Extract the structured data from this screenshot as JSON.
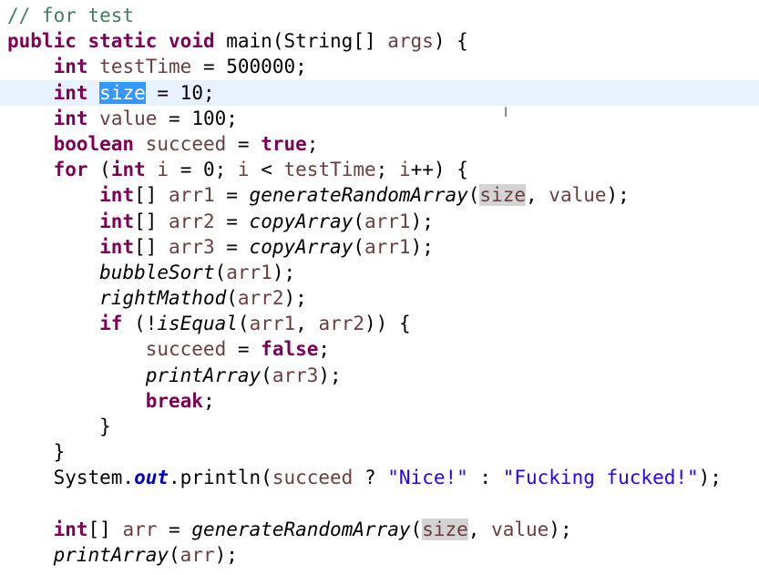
{
  "editor": {
    "language": "java",
    "lines": [
      {
        "tokens": [
          {
            "t": "// for test",
            "c": "cm"
          }
        ]
      },
      {
        "tokens": [
          {
            "t": "public",
            "c": "kw"
          },
          {
            "t": " "
          },
          {
            "t": "static",
            "c": "kw"
          },
          {
            "t": " "
          },
          {
            "t": "void",
            "c": "kw"
          },
          {
            "t": " main(String[] "
          },
          {
            "t": "args",
            "c": "var"
          },
          {
            "t": ") {"
          }
        ]
      },
      {
        "tokens": [
          {
            "t": "    "
          },
          {
            "t": "int",
            "c": "kw"
          },
          {
            "t": " "
          },
          {
            "t": "testTime",
            "c": "var"
          },
          {
            "t": " = 500000;"
          }
        ]
      },
      {
        "current": true,
        "tokens": [
          {
            "t": "    "
          },
          {
            "t": "int",
            "c": "kw"
          },
          {
            "t": " "
          },
          {
            "t": "size",
            "c": "sel"
          },
          {
            "t": " = 10;"
          }
        ]
      },
      {
        "tokens": [
          {
            "t": "    "
          },
          {
            "t": "int",
            "c": "kw"
          },
          {
            "t": " "
          },
          {
            "t": "value",
            "c": "var"
          },
          {
            "t": " = 100;"
          }
        ]
      },
      {
        "tokens": [
          {
            "t": "    "
          },
          {
            "t": "boolean",
            "c": "kw"
          },
          {
            "t": " "
          },
          {
            "t": "succeed",
            "c": "var"
          },
          {
            "t": " = "
          },
          {
            "t": "true",
            "c": "kw"
          },
          {
            "t": ";"
          }
        ]
      },
      {
        "tokens": [
          {
            "t": "    "
          },
          {
            "t": "for",
            "c": "kw"
          },
          {
            "t": " ("
          },
          {
            "t": "int",
            "c": "kw"
          },
          {
            "t": " "
          },
          {
            "t": "i",
            "c": "var"
          },
          {
            "t": " = 0; "
          },
          {
            "t": "i",
            "c": "var"
          },
          {
            "t": " < "
          },
          {
            "t": "testTime",
            "c": "var"
          },
          {
            "t": "; "
          },
          {
            "t": "i",
            "c": "var"
          },
          {
            "t": "++) {"
          }
        ]
      },
      {
        "tokens": [
          {
            "t": "        "
          },
          {
            "t": "int",
            "c": "kw"
          },
          {
            "t": "[] "
          },
          {
            "t": "arr1",
            "c": "var"
          },
          {
            "t": " = "
          },
          {
            "t": "generateRandomArray",
            "c": "it"
          },
          {
            "t": "("
          },
          {
            "t": "size",
            "c": "occ var"
          },
          {
            "t": ", "
          },
          {
            "t": "value",
            "c": "var"
          },
          {
            "t": ");"
          }
        ]
      },
      {
        "tokens": [
          {
            "t": "        "
          },
          {
            "t": "int",
            "c": "kw"
          },
          {
            "t": "[] "
          },
          {
            "t": "arr2",
            "c": "var"
          },
          {
            "t": " = "
          },
          {
            "t": "copyArray",
            "c": "it"
          },
          {
            "t": "("
          },
          {
            "t": "arr1",
            "c": "var"
          },
          {
            "t": ");"
          }
        ]
      },
      {
        "tokens": [
          {
            "t": "        "
          },
          {
            "t": "int",
            "c": "kw"
          },
          {
            "t": "[] "
          },
          {
            "t": "arr3",
            "c": "var"
          },
          {
            "t": " = "
          },
          {
            "t": "copyArray",
            "c": "it"
          },
          {
            "t": "("
          },
          {
            "t": "arr1",
            "c": "var"
          },
          {
            "t": ");"
          }
        ]
      },
      {
        "tokens": [
          {
            "t": "        "
          },
          {
            "t": "bubbleSort",
            "c": "it"
          },
          {
            "t": "("
          },
          {
            "t": "arr1",
            "c": "var"
          },
          {
            "t": ");"
          }
        ]
      },
      {
        "tokens": [
          {
            "t": "        "
          },
          {
            "t": "rightMathod",
            "c": "it"
          },
          {
            "t": "("
          },
          {
            "t": "arr2",
            "c": "var"
          },
          {
            "t": ");"
          }
        ]
      },
      {
        "tokens": [
          {
            "t": "        "
          },
          {
            "t": "if",
            "c": "kw"
          },
          {
            "t": " (!"
          },
          {
            "t": "isEqual",
            "c": "it"
          },
          {
            "t": "("
          },
          {
            "t": "arr1",
            "c": "var"
          },
          {
            "t": ", "
          },
          {
            "t": "arr2",
            "c": "var"
          },
          {
            "t": ")) {"
          }
        ]
      },
      {
        "tokens": [
          {
            "t": "            "
          },
          {
            "t": "succeed",
            "c": "var"
          },
          {
            "t": " = "
          },
          {
            "t": "false",
            "c": "kw"
          },
          {
            "t": ";"
          }
        ]
      },
      {
        "tokens": [
          {
            "t": "            "
          },
          {
            "t": "printArray",
            "c": "it"
          },
          {
            "t": "("
          },
          {
            "t": "arr3",
            "c": "var"
          },
          {
            "t": ");"
          }
        ]
      },
      {
        "tokens": [
          {
            "t": "            "
          },
          {
            "t": "break",
            "c": "kw"
          },
          {
            "t": ";"
          }
        ]
      },
      {
        "tokens": [
          {
            "t": "        }"
          }
        ]
      },
      {
        "tokens": [
          {
            "t": "    }"
          }
        ]
      },
      {
        "tokens": [
          {
            "t": "    System."
          },
          {
            "t": "out",
            "c": "field"
          },
          {
            "t": ".println("
          },
          {
            "t": "succeed",
            "c": "var"
          },
          {
            "t": " ? "
          },
          {
            "t": "\"Nice!\"",
            "c": "str"
          },
          {
            "t": " : "
          },
          {
            "t": "\"Fucking fucked!\"",
            "c": "str"
          },
          {
            "t": ");"
          }
        ]
      },
      {
        "tokens": [
          {
            "t": ""
          }
        ]
      },
      {
        "tokens": [
          {
            "t": "    "
          },
          {
            "t": "int",
            "c": "kw"
          },
          {
            "t": "[] "
          },
          {
            "t": "arr",
            "c": "var"
          },
          {
            "t": " = "
          },
          {
            "t": "generateRandomArray",
            "c": "it"
          },
          {
            "t": "("
          },
          {
            "t": "size",
            "c": "occ var"
          },
          {
            "t": ", "
          },
          {
            "t": "value",
            "c": "var"
          },
          {
            "t": ");"
          }
        ]
      },
      {
        "tokens": [
          {
            "t": "    "
          },
          {
            "t": "printArray",
            "c": "it"
          },
          {
            "t": "("
          },
          {
            "t": "arr",
            "c": "var"
          },
          {
            "t": ");"
          }
        ]
      }
    ]
  },
  "icons": {
    "mouse_cursor": "text-ibeam-cursor-icon"
  },
  "colors": {
    "keyword": "#7f0055",
    "comment": "#3f7f5f",
    "local_variable": "#6a3e3e",
    "string": "#2a00ff",
    "static_field": "#0000c0",
    "selection": "#3399ff",
    "occurrence_highlight": "#d4d4d4",
    "current_line": "#e8f2fe"
  }
}
